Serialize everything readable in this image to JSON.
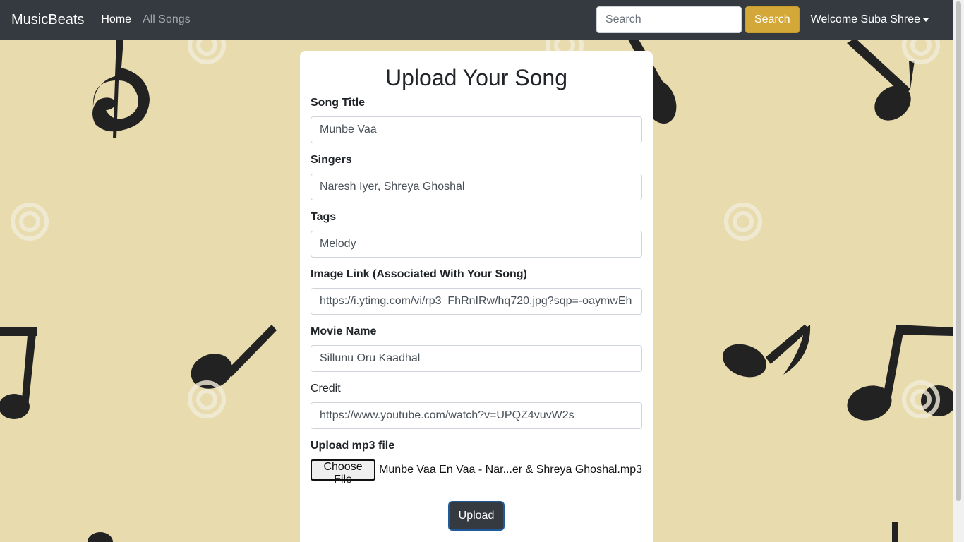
{
  "navbar": {
    "brand": "MusicBeats",
    "links": [
      {
        "label": "Home"
      },
      {
        "label": "All Songs"
      }
    ],
    "search": {
      "placeholder": "Search",
      "button_label": "Search"
    },
    "user_menu_label": "Welcome Suba Shree"
  },
  "form": {
    "title": "Upload Your Song",
    "fields": {
      "song_title": {
        "label": "Song Title",
        "value": "Munbe Vaa"
      },
      "singers": {
        "label": "Singers",
        "value": "Naresh Iyer, Shreya Ghoshal"
      },
      "tags": {
        "label": "Tags",
        "value": "Melody"
      },
      "image_link": {
        "label": "Image Link (Associated With Your Song)",
        "value": "https://i.ytimg.com/vi/rp3_FhRnIRw/hq720.jpg?sqp=-oaymwEh"
      },
      "movie_name": {
        "label": "Movie Name",
        "value": "Sillunu Oru Kaadhal"
      },
      "credit": {
        "label": "Credit",
        "value": "https://www.youtube.com/watch?v=UPQZ4vuvW2s"
      }
    },
    "file": {
      "label": "Upload mp3 file",
      "button_label": "Choose File",
      "file_name": "Munbe Vaa En Vaa - Nar...er & Shreya Ghoshal.mp3"
    },
    "submit_label": "Upload"
  },
  "colors": {
    "navbar_bg": "#343a40",
    "page_bg": "#e8dcaf",
    "search_button": "#d4a838",
    "note_color": "#222222"
  }
}
